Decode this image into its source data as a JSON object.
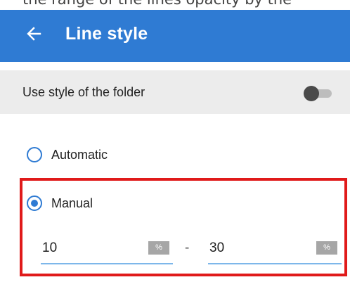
{
  "appbar": {
    "title": "Line style",
    "back_icon": "arrow-left-icon",
    "color": "#2f7bd3"
  },
  "top_strip": {
    "text": "the range of the lines opacity by the"
  },
  "folder_style": {
    "label": "Use style of the folder",
    "toggle_on": false
  },
  "style_mode": {
    "options": [
      {
        "label": "Automatic",
        "checked": false
      },
      {
        "label": "Manual",
        "checked": true
      }
    ]
  },
  "range": {
    "min": {
      "value": "10",
      "unit": "%"
    },
    "separator": "-",
    "max": {
      "value": "30",
      "unit": "%"
    }
  },
  "highlight_color": "#e01a1a"
}
